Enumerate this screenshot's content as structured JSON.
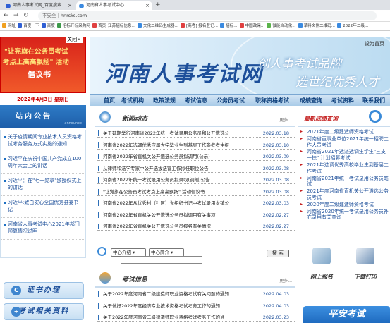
{
  "browser": {
    "tabs": [
      {
        "title": "河南人事考试网_百度搜索",
        "fav_color": "#2f5fd4"
      },
      {
        "title": "河南省人事考试中心",
        "fav_color": "#3b8ae0"
      }
    ],
    "new_tab": "+",
    "close": "×",
    "security": "不安全",
    "url": "hnrsks.com",
    "bookmarks": [
      {
        "label": "网址",
        "color": "#f0a020"
      },
      {
        "label": "百度一下",
        "color": "#2f5fd4"
      },
      {
        "label": "百度",
        "color": "#2f5fd4"
      },
      {
        "label": "招标开标采购网",
        "color": "#3d9a4a"
      },
      {
        "label": "首页_江苏招标信息...",
        "color": "#e04040"
      },
      {
        "label": "文化二维码生成器...",
        "color": "#3b8ae0"
      },
      {
        "label": "[高考] 报名登记...",
        "color": "#e04040"
      },
      {
        "label": "招标...",
        "color": "#3b8ae0"
      },
      {
        "label": "中国政采...",
        "color": "#e04040"
      },
      {
        "label": "微能自动化...",
        "color": "#5ab34a"
      },
      {
        "label": "草料文件二维码...",
        "color": "#3b8ae0"
      },
      {
        "label": "2022年二级...",
        "color": "#3b8ae0"
      }
    ]
  },
  "header": {
    "site_title": "河南人事考试网",
    "slogan_1": "创人事考试品牌",
    "slogan_2": "选世纪优秀人才",
    "home_link": "设为首页"
  },
  "left_ad": {
    "close": "关闭×",
    "line1": "\"让宪旗在公务员考试",
    "line2": "考点上高高飘扬\" 活动",
    "line3": "倡议书"
  },
  "nav": {
    "items": [
      "首页",
      "考试机构",
      "政策法规",
      "考试信息",
      "公务员考试",
      "职称资格考试",
      "成绩查询",
      "考试资料",
      "联系我们"
    ]
  },
  "sidebar": {
    "date": "2022年4月3日 星期日",
    "notice_title": "站内公告",
    "notice_sub": "announce",
    "notices": [
      "关于疫情期间专业技术人员资格考试考务服务方式实施的通知",
      "习近平在庆祝中国共产党成立100周年大会上的讲话",
      "习近平：在\"七一勋章\"颁授仪式上的讲话",
      "习近平:致白安心全国优秀县委书记",
      "河南省人事考试中心2021年部门预算情况说明"
    ],
    "btn_certificate": "证书办理",
    "btn_materials": "考试相关资料"
  },
  "news": {
    "title": "新闻动态",
    "more": "更多...",
    "rows": [
      {
        "title": "关于延期举行河南省2022年统一考试录用公务员和公开遴选公",
        "date": "2022.03.18"
      },
      {
        "title": "河南省2022年选调优秀应届大学毕业生到基层工作参考考生报",
        "date": "2022.03.10"
      },
      {
        "title": "河南省2022年省直机关公开遴选公务员拟调用(公示)",
        "date": "2022.03.09"
      },
      {
        "title": "从律师和法学专家中公开选拔法官工作拟任职位公告",
        "date": "2022.03.08"
      },
      {
        "title": "河南省2022年统一考试录用公务员拟录取(调剂)公告",
        "date": "2022.03.08"
      },
      {
        "title": "\"让党旗在公务员考试考点上高高飘扬\" 活动倡议书",
        "date": "2022.03.08"
      },
      {
        "title": "河南省2022年从优秀村（社区）党组织书记中考试录用乡镇公",
        "date": "2022.03.03"
      },
      {
        "title": "河南省2022年省直机关公开遴选公务员拟调用有关事项",
        "date": "2022.02.27"
      },
      {
        "title": "河南省2022年省直机关公开遴选公务员报名有关情况",
        "date": "2022.02.27"
      }
    ]
  },
  "search": {
    "select1": "中心介绍",
    "select2": "中心简介",
    "button": "搜 索"
  },
  "exam": {
    "title": "考试信息",
    "more": "更多...",
    "rows": [
      {
        "title": "关于2022年度河南省二级建造师职业资格考试有关问题的通知",
        "date": "2022.04.03"
      },
      {
        "title": "关于做好2022年度经济专业技术资格考试考务工作的通知",
        "date": "2022.04.03"
      },
      {
        "title": "关于2022年度河南省二级建造师职业资格考试考务工作的通",
        "date": "2022.03.23"
      }
    ]
  },
  "results": {
    "title": "最新成绩查询",
    "items": [
      "2021年度二级建造师资格考试",
      "河南省直事业单位2021年统一招聘工作人员考试",
      "河南省2021年选派选调生学生\"三支一扶\" 计划招募考试",
      "2021年选调优秀高校毕业生到基层工作考试",
      "河南省2021年统一考试录用公务员笔试",
      "2021年度河南省直机关公开遴选公务员考试",
      "2020年度二级建造师资格考试",
      "河南省2020年统一考试录用公务员补充录用有关查询"
    ]
  },
  "quick": {
    "apply": "网上报名",
    "download": "下载打印"
  },
  "bottom_ad": {
    "text": "平安考试"
  }
}
